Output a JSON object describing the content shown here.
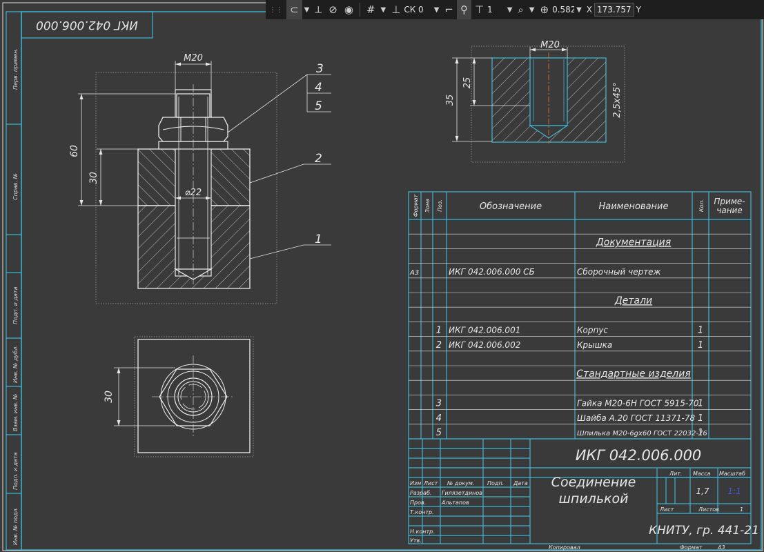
{
  "toolbar": {
    "cs_label": "СК 0",
    "layer_value": "1",
    "zoom_value": "0.582",
    "x_label": "X",
    "x_value": "173.757",
    "y_label": "Y"
  },
  "drawing": {
    "stamp_top": "ИКГ 042.006.000",
    "side_labels": [
      "Перв. примен.",
      "Справ. №",
      "Подп. и дата",
      "Инв. № дубл.",
      "Взам. инв. №",
      "Подп. и дата",
      "Инв. № подл."
    ],
    "views": {
      "front_m20": "М20",
      "front_60": "60",
      "front_30": "30",
      "front_d22": "⌀22",
      "callouts": [
        "3",
        "4",
        "5",
        "2",
        "1"
      ],
      "top_30": "30",
      "detail_m20": "М20",
      "detail_35": "35",
      "detail_25": "25",
      "detail_chamfer": "2,5x45°"
    }
  },
  "spec": {
    "headers": {
      "format": "Формат",
      "zone": "Зона",
      "pos": "Поз.",
      "designation": "Обозначение",
      "name": "Наименование",
      "qty": "Кол.",
      "note": "Приме-\nчание"
    },
    "rows": [
      {
        "format": "",
        "pos": "",
        "designation": "",
        "name": "",
        "qty": ""
      },
      {
        "format": "",
        "pos": "",
        "designation": "",
        "name": "Документация",
        "qty": "",
        "section": true
      },
      {
        "format": "",
        "pos": "",
        "designation": "",
        "name": "",
        "qty": ""
      },
      {
        "format": "А3",
        "pos": "",
        "designation": "ИКГ 042.006.000 СБ",
        "name": "Сборочный чертеж",
        "qty": ""
      },
      {
        "format": "",
        "pos": "",
        "designation": "",
        "name": "",
        "qty": ""
      },
      {
        "format": "",
        "pos": "",
        "designation": "",
        "name": "Детали",
        "qty": "",
        "section": true
      },
      {
        "format": "",
        "pos": "",
        "designation": "",
        "name": "",
        "qty": ""
      },
      {
        "format": "",
        "pos": "1",
        "designation": "ИКГ 042.006.001",
        "name": "Корпус",
        "qty": "1"
      },
      {
        "format": "",
        "pos": "2",
        "designation": "ИКГ 042.006.002",
        "name": "Крышка",
        "qty": "1"
      },
      {
        "format": "",
        "pos": "",
        "designation": "",
        "name": "",
        "qty": ""
      },
      {
        "format": "",
        "pos": "",
        "designation": "",
        "name": "Стандартные изделия",
        "qty": "",
        "section": true
      },
      {
        "format": "",
        "pos": "",
        "designation": "",
        "name": "",
        "qty": ""
      },
      {
        "format": "",
        "pos": "3",
        "designation": "",
        "name": "Гайка М20-6Н ГОСТ 5915-70",
        "qty": "1"
      },
      {
        "format": "",
        "pos": "4",
        "designation": "",
        "name": "Шайба А.20 ГОСТ 11371-78",
        "qty": "1"
      },
      {
        "format": "",
        "pos": "5",
        "designation": "",
        "name": "Шпилька М20-6gх60 ГОСТ 22032-76",
        "qty": "1"
      }
    ]
  },
  "title_block": {
    "designation": "ИКГ 042.006.000",
    "title_line1": "Соединение",
    "title_line2": "шпилькой",
    "col_izm": "Изм",
    "col_list": "Лист",
    "col_doc": "№ докум.",
    "col_sign": "Подп.",
    "col_date": "Дата",
    "razrab": "Разраб.",
    "razrab_name": "Гилязетдинов",
    "prov": "Пров.",
    "prov_name": "Альтапов",
    "tkontr": "Т.контр.",
    "nkontr": "Н.контр.",
    "utv": "Утв.",
    "lit": "Лит.",
    "massa": "Масса",
    "masshtab": "Масштаб",
    "mass_value": "1,7",
    "scale_value": "1:1",
    "list": "Лист",
    "listov": "Листов",
    "listov_value": "1",
    "org": "КНИТУ, гр. 441-21",
    "copied": "Копировал",
    "format_label": "Формат",
    "format_value": "А3"
  }
}
